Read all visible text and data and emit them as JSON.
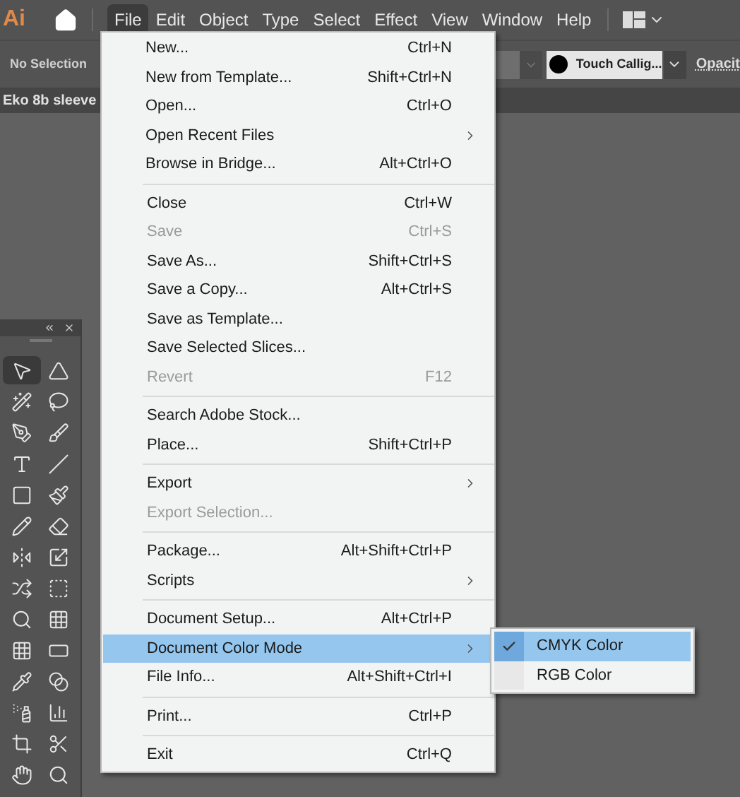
{
  "app_logo": "Ai",
  "menubar": [
    {
      "label": "File",
      "selected": true
    },
    {
      "label": "Edit",
      "selected": false
    },
    {
      "label": "Object",
      "selected": false
    },
    {
      "label": "Type",
      "selected": false
    },
    {
      "label": "Select",
      "selected": false
    },
    {
      "label": "Effect",
      "selected": false
    },
    {
      "label": "View",
      "selected": false
    },
    {
      "label": "Window",
      "selected": false
    },
    {
      "label": "Help",
      "selected": false
    }
  ],
  "control_bar": {
    "selection": "No Selection",
    "brush": "Touch Callig...",
    "opacity_label": "Opacit"
  },
  "document_tab": "Eko 8b sleeve",
  "toolbar": {
    "tools": [
      {
        "selected": true
      },
      {
        "selected": false
      },
      {
        "selected": false
      },
      {
        "selected": false
      },
      {
        "selected": false
      },
      {
        "selected": false
      },
      {
        "selected": false
      },
      {
        "selected": false
      },
      {
        "selected": false
      },
      {
        "selected": false
      },
      {
        "selected": false
      },
      {
        "selected": false
      },
      {
        "selected": false
      },
      {
        "selected": false
      },
      {
        "selected": false
      },
      {
        "selected": false
      },
      {
        "selected": false
      },
      {
        "selected": false
      },
      {
        "selected": false
      },
      {
        "selected": false
      },
      {
        "selected": false
      },
      {
        "selected": false
      },
      {
        "selected": false
      },
      {
        "selected": false
      },
      {
        "selected": false
      },
      {
        "selected": false
      },
      {
        "selected": false
      },
      {
        "selected": false
      }
    ]
  },
  "file_menu": {
    "groups": [
      {
        "items": [
          {
            "label": "New...",
            "shortcut": "Ctrl+N",
            "disabled": false,
            "submenu": false,
            "selected": false
          },
          {
            "label": "New from Template...",
            "shortcut": "Shift+Ctrl+N",
            "disabled": false,
            "submenu": false,
            "selected": false
          },
          {
            "label": "Open...",
            "shortcut": "Ctrl+O",
            "disabled": false,
            "submenu": false,
            "selected": false
          },
          {
            "label": "Open Recent Files",
            "disabled": false,
            "submenu": true,
            "selected": false
          },
          {
            "label": "Browse in Bridge...",
            "shortcut": "Alt+Ctrl+O",
            "disabled": false,
            "submenu": false,
            "selected": false
          }
        ]
      },
      {
        "items": [
          {
            "label": "Close",
            "shortcut": "Ctrl+W",
            "disabled": false,
            "submenu": false,
            "selected": false
          },
          {
            "label": "Save",
            "shortcut": "Ctrl+S",
            "disabled": true,
            "submenu": false,
            "selected": false
          },
          {
            "label": "Save As...",
            "shortcut": "Shift+Ctrl+S",
            "disabled": false,
            "submenu": false,
            "selected": false
          },
          {
            "label": "Save a Copy...",
            "shortcut": "Alt+Ctrl+S",
            "disabled": false,
            "submenu": false,
            "selected": false
          },
          {
            "label": "Save as Template...",
            "disabled": false,
            "submenu": false,
            "selected": false
          },
          {
            "label": "Save Selected Slices...",
            "disabled": false,
            "submenu": false,
            "selected": false
          },
          {
            "label": "Revert",
            "shortcut": "F12",
            "disabled": true,
            "submenu": false,
            "selected": false
          }
        ]
      },
      {
        "items": [
          {
            "label": "Search Adobe Stock...",
            "disabled": false,
            "submenu": false,
            "selected": false
          },
          {
            "label": "Place...",
            "shortcut": "Shift+Ctrl+P",
            "disabled": false,
            "submenu": false,
            "selected": false
          }
        ]
      },
      {
        "items": [
          {
            "label": "Export",
            "disabled": false,
            "submenu": true,
            "selected": false
          },
          {
            "label": "Export Selection...",
            "disabled": true,
            "submenu": false,
            "selected": false
          }
        ]
      },
      {
        "items": [
          {
            "label": "Package...",
            "shortcut": "Alt+Shift+Ctrl+P",
            "disabled": false,
            "submenu": false,
            "selected": false
          },
          {
            "label": "Scripts",
            "disabled": false,
            "submenu": true,
            "selected": false
          }
        ]
      },
      {
        "items": [
          {
            "label": "Document Setup...",
            "shortcut": "Alt+Ctrl+P",
            "disabled": false,
            "submenu": false,
            "selected": false
          },
          {
            "label": "Document Color Mode",
            "disabled": false,
            "submenu": true,
            "selected": true
          },
          {
            "label": "File Info...",
            "shortcut": "Alt+Shift+Ctrl+I",
            "disabled": false,
            "submenu": false,
            "selected": false
          }
        ]
      },
      {
        "items": [
          {
            "label": "Print...",
            "shortcut": "Ctrl+P",
            "disabled": false,
            "submenu": false,
            "selected": false
          }
        ]
      },
      {
        "items": [
          {
            "label": "Exit",
            "shortcut": "Ctrl+Q",
            "disabled": false,
            "submenu": false,
            "selected": false
          }
        ]
      }
    ]
  },
  "color_mode_submenu": [
    {
      "label": "CMYK Color",
      "checked": true,
      "selected": true
    },
    {
      "label": "RGB Color",
      "checked": false,
      "selected": false
    }
  ]
}
